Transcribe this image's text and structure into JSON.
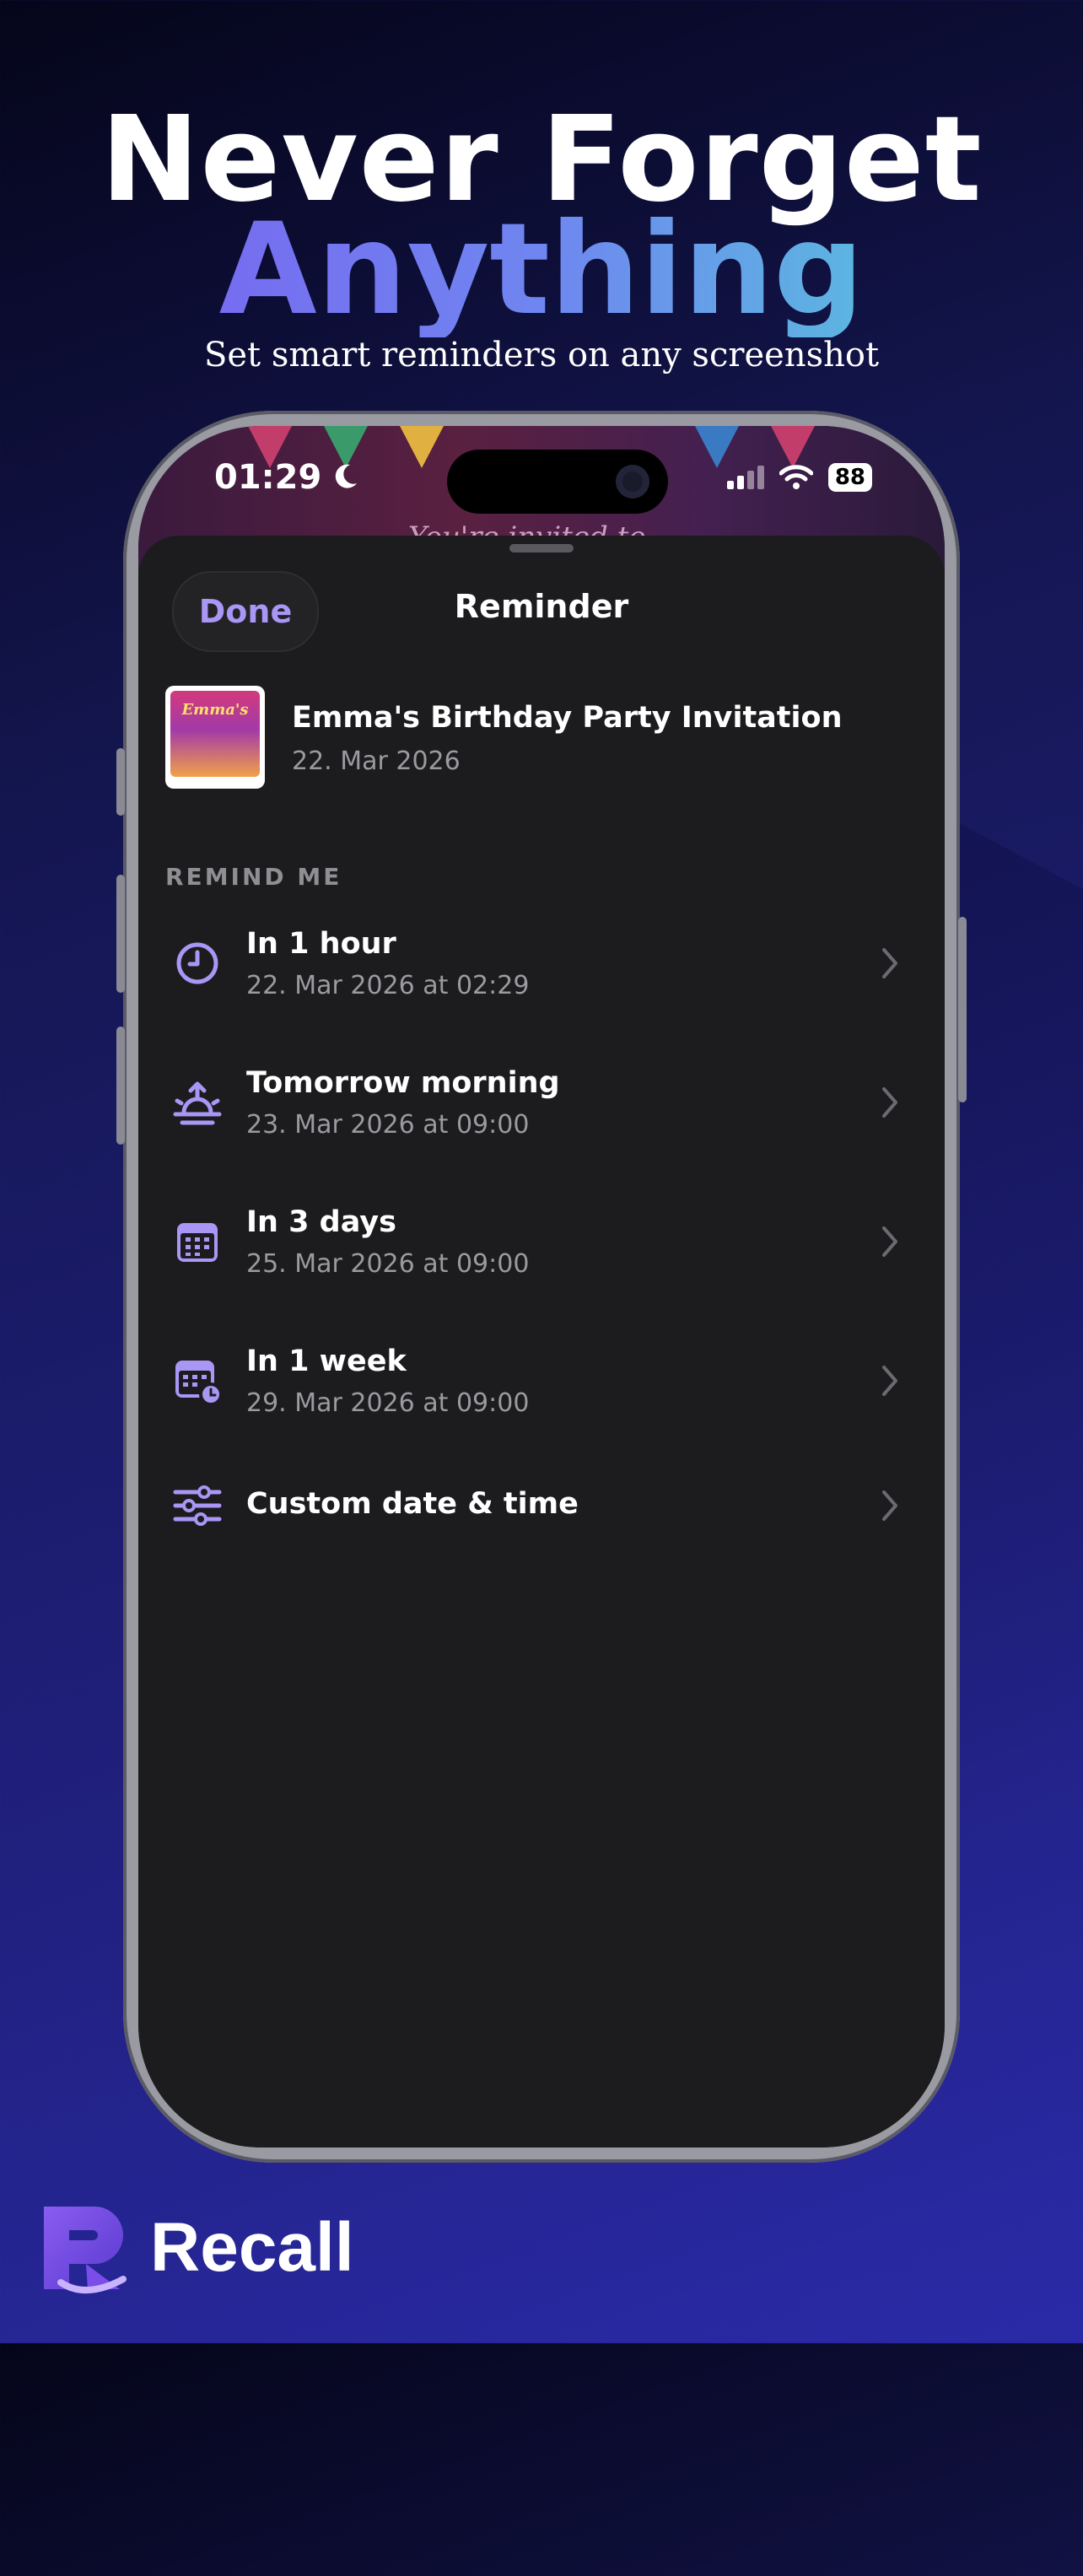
{
  "promo": {
    "headline_line1": "Never Forget",
    "headline_line2": "Anything",
    "subtitle": "Set smart reminders on any screenshot",
    "brand_name": "Recall"
  },
  "status_bar": {
    "time": "01:29",
    "battery": "88"
  },
  "background_snippet": "You're invited to",
  "sheet": {
    "done_label": "Done",
    "title": "Reminder"
  },
  "item": {
    "title": "Emma's Birthday Party Invitation",
    "date": "22. Mar 2026",
    "thumbnail_text": "Emma's"
  },
  "section_label": "REMIND ME",
  "options": [
    {
      "icon": "clock-icon",
      "title": "In 1 hour",
      "subtitle": "22. Mar 2026 at 02:29"
    },
    {
      "icon": "sunrise-icon",
      "title": "Tomorrow morning",
      "subtitle": "23. Mar 2026 at 09:00"
    },
    {
      "icon": "calendar-icon",
      "title": "In 3 days",
      "subtitle": "25. Mar 2026 at 09:00"
    },
    {
      "icon": "calendar-clock-icon",
      "title": "In 1 week",
      "subtitle": "29. Mar 2026 at 09:00"
    },
    {
      "icon": "sliders-icon",
      "title": "Custom date & time",
      "subtitle": ""
    }
  ],
  "colors": {
    "accent": "#a996f5",
    "sheet_bg": "#1c1c1e",
    "secondary_text": "#9a9a9f"
  }
}
